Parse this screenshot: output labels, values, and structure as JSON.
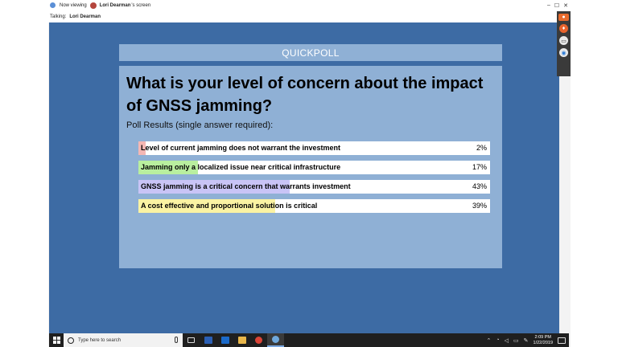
{
  "title_bar": {
    "viewing_label": "Now viewing",
    "presenter_name": "Lori Dearman",
    "suffix": "'s screen"
  },
  "talking_bar": {
    "label": "Talking:",
    "name": "Lori Dearman"
  },
  "window_controls": {
    "minimize": "–",
    "maximize": "☐",
    "close": "✕"
  },
  "side_toolbar": {
    "buttons": [
      "record-icon",
      "microphone-icon",
      "screen-icon",
      "webcam-icon"
    ]
  },
  "poll": {
    "header": "QUICKPOLL",
    "question": "What is your level of concern about the impact of GNSS jamming?",
    "subtitle": "Poll Results (single answer required):",
    "results": [
      {
        "label": "Level of current  jamming does not warrant the investment",
        "percent_label": "2%",
        "percent": 2,
        "color": "#f4b7b4"
      },
      {
        "label": "Jamming only a localized issue near critical infrastructure",
        "percent_label": "17%",
        "percent": 17,
        "color": "#b9ef9f"
      },
      {
        "label": "GNSS jamming is a critical concern that warrants investment",
        "percent_label": "43%",
        "percent": 43,
        "color": "#c9c4f6"
      },
      {
        "label": "A cost effective and proportional solution is critical",
        "percent_label": "39%",
        "percent": 39,
        "color": "#fbf3a3"
      }
    ]
  },
  "taskbar": {
    "search_placeholder": "Type here to search",
    "apps": [
      "task-view-icon",
      "word-icon",
      "outlook-icon",
      "file-explorer-icon",
      "chrome-icon",
      "meeting-app-icon"
    ],
    "clock_time": "2:09 PM",
    "clock_date": "1/22/2019"
  }
}
